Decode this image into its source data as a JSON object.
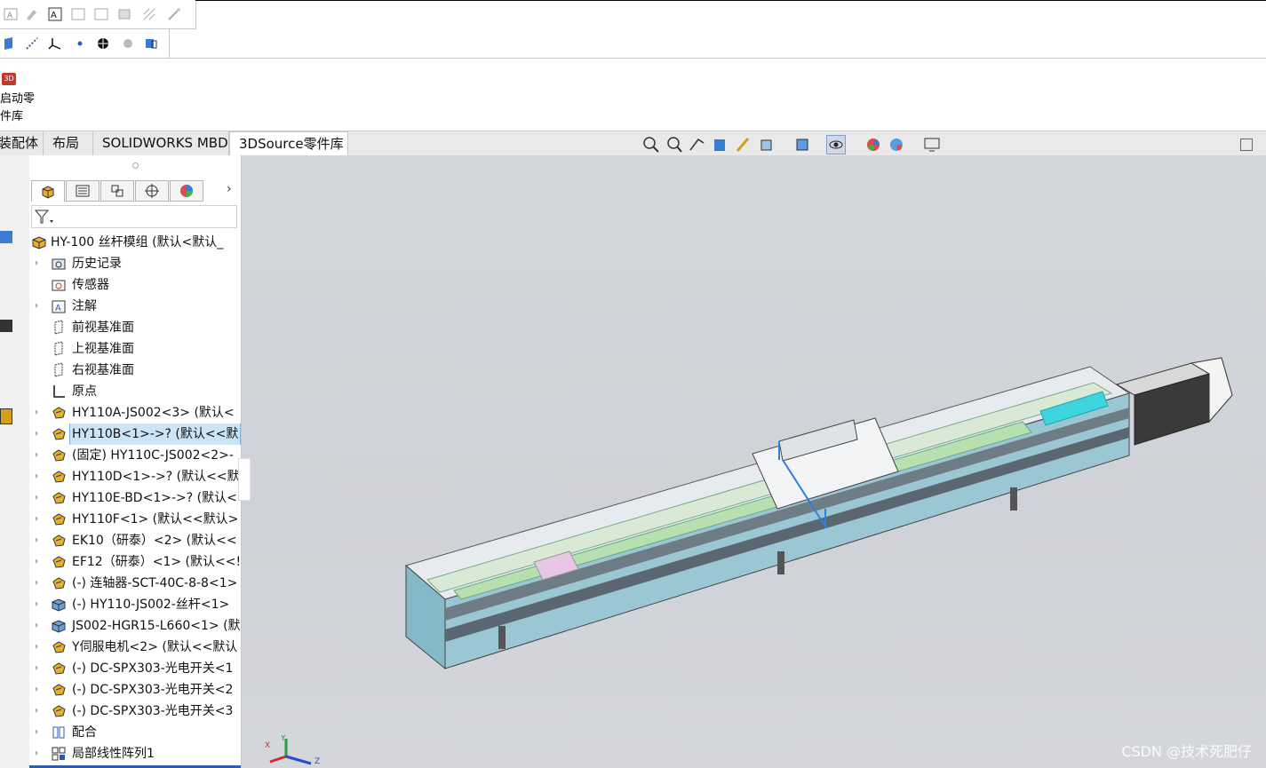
{
  "command_manager": {
    "block_label_line1": "启动零",
    "block_label_line2": "件库",
    "block_icon": "3D"
  },
  "tabs": [
    {
      "label": "装配体",
      "active": false
    },
    {
      "label": "布局",
      "active": false
    },
    {
      "label": "SOLIDWORKS MBD",
      "active": false
    },
    {
      "label": "3DSource零件库",
      "active": true
    }
  ],
  "feature_tree": {
    "root": "HY-100 丝杆模组  (默认<默认_",
    "items": [
      {
        "label": "历史记录",
        "icon": "history-folder-icon",
        "expand": true
      },
      {
        "label": "传感器",
        "icon": "sensor-icon",
        "expand": false
      },
      {
        "label": "注解",
        "icon": "annotation-icon",
        "expand": true
      },
      {
        "label": "前视基准面",
        "icon": "plane-icon",
        "expand": false
      },
      {
        "label": "上视基准面",
        "icon": "plane-icon",
        "expand": false
      },
      {
        "label": "右视基准面",
        "icon": "plane-icon",
        "expand": false
      },
      {
        "label": "原点",
        "icon": "origin-icon",
        "expand": false
      },
      {
        "label": "HY110A-JS002<3> (默认<",
        "icon": "subassembly-icon",
        "expand": true
      },
      {
        "label": "HY110B<1>->? (默认<<默",
        "icon": "subassembly-icon",
        "expand": true,
        "selected": true
      },
      {
        "label": "(固定) HY110C-JS002<2>-",
        "icon": "subassembly-icon",
        "expand": true
      },
      {
        "label": "HY110D<1>->? (默认<<默",
        "icon": "subassembly-icon",
        "expand": true
      },
      {
        "label": "HY110E-BD<1>->? (默认<",
        "icon": "subassembly-icon",
        "expand": true
      },
      {
        "label": "HY110F<1> (默认<<默认>",
        "icon": "subassembly-icon",
        "expand": true
      },
      {
        "label": "EK10（研泰）<2> (默认<<",
        "icon": "subassembly-icon",
        "expand": true
      },
      {
        "label": "EF12（研泰）<1> (默认<<!",
        "icon": "subassembly-icon",
        "expand": true
      },
      {
        "label": "(-) 连轴器-SCT-40C-8-8<1>",
        "icon": "subassembly-icon",
        "expand": true
      },
      {
        "label": "(-) HY110-JS002-丝杆<1>",
        "icon": "part-icon",
        "expand": true
      },
      {
        "label": "JS002-HGR15-L660<1> (默",
        "icon": "part-icon",
        "expand": true
      },
      {
        "label": "Y伺服电机<2> (默认<<默认",
        "icon": "subassembly-icon",
        "expand": true
      },
      {
        "label": "(-) DC-SPX303-光电开关<1",
        "icon": "subassembly-icon",
        "expand": true
      },
      {
        "label": "(-) DC-SPX303-光电开关<2",
        "icon": "subassembly-icon",
        "expand": true
      },
      {
        "label": "(-) DC-SPX303-光电开关<3",
        "icon": "subassembly-icon",
        "expand": true
      },
      {
        "label": "配合",
        "icon": "mates-icon",
        "expand": true
      },
      {
        "label": "局部线性阵列1",
        "icon": "pattern-icon",
        "expand": true
      }
    ]
  },
  "watermark": "CSDN @技术死肥仔",
  "colors": {
    "viewport_bg": "#d1d4da",
    "selection": "#cde4f7",
    "accent": "#2a5db0"
  }
}
